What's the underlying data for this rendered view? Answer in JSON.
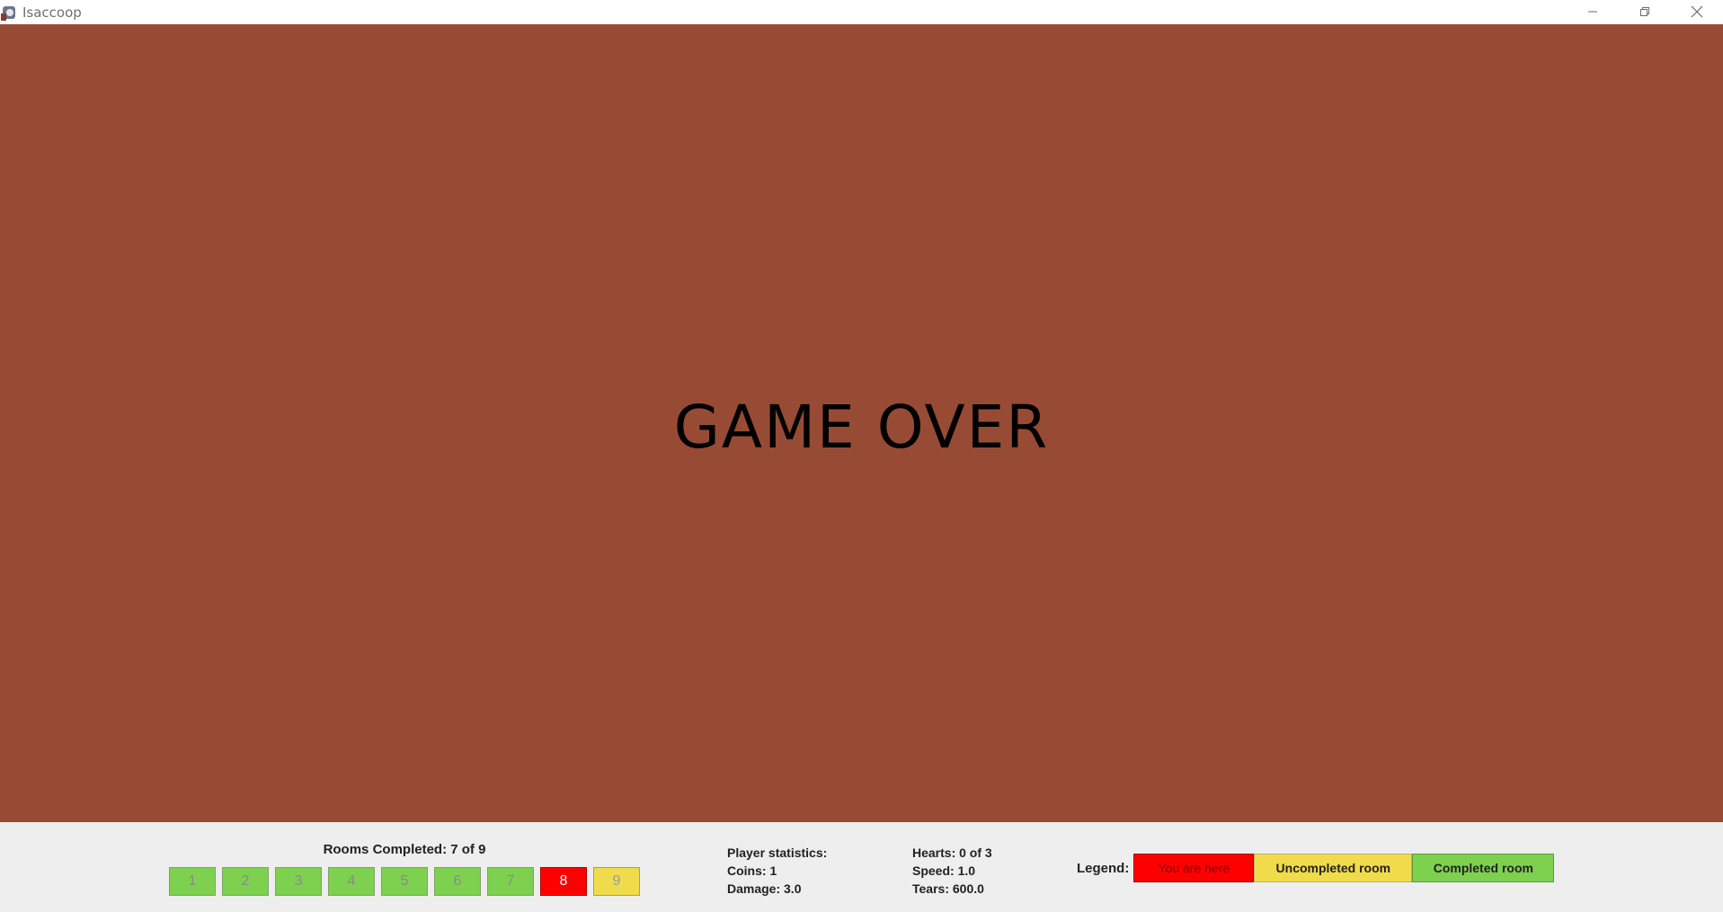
{
  "window": {
    "title": "Isaccoop",
    "controls": [
      "minimize-icon",
      "restore-icon",
      "close-icon"
    ]
  },
  "game": {
    "message": "GAME OVER",
    "background_color": "#984b34"
  },
  "rooms": {
    "title": "Rooms Completed: 7 of 9",
    "items": [
      {
        "label": "1",
        "state": "completed"
      },
      {
        "label": "2",
        "state": "completed"
      },
      {
        "label": "3",
        "state": "completed"
      },
      {
        "label": "4",
        "state": "completed"
      },
      {
        "label": "5",
        "state": "completed"
      },
      {
        "label": "6",
        "state": "completed"
      },
      {
        "label": "7",
        "state": "completed"
      },
      {
        "label": "8",
        "state": "current"
      },
      {
        "label": "9",
        "state": "uncompleted"
      }
    ]
  },
  "stats": {
    "heading": "Player statistics:",
    "coins": "Coins: 1",
    "damage": "Damage: 3.0",
    "hearts": "Hearts: 0 of 3",
    "speed": "Speed: 1.0",
    "tears": "Tears: 600.0"
  },
  "legend": {
    "label": "Legend:",
    "here": "You are here",
    "uncompleted": "Uncompleted room",
    "completed": "Completed room",
    "colors": {
      "here": "#ff0000",
      "uncompleted": "#f0dc4a",
      "completed": "#7ed14f"
    }
  }
}
